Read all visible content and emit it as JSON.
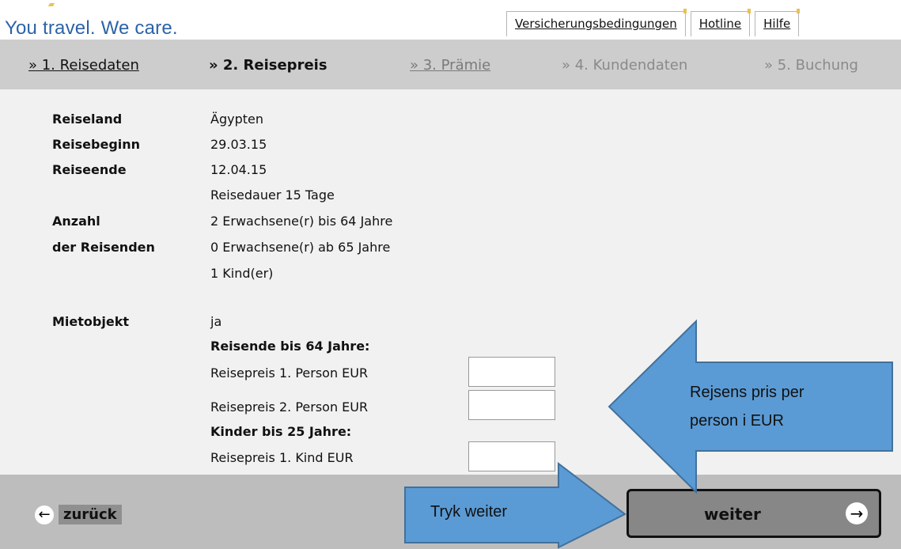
{
  "brand": {
    "tagline": "You travel. We care."
  },
  "toplinks": [
    "Versicherungsbedingungen",
    "Hotline",
    "Hilfe"
  ],
  "steps": [
    {
      "label": "» 1. Reisedaten"
    },
    {
      "label": "» 2. Reisepreis"
    },
    {
      "label": "» 3. Prämie"
    },
    {
      "label": "» 4. Kundendaten"
    },
    {
      "label": "» 5. Buchung"
    }
  ],
  "summary": {
    "reiseland_label": "Reiseland",
    "reiseland_value": "Ägypten",
    "reisebeginn_label": "Reisebeginn",
    "reisebeginn_value": "29.03.15",
    "reiseende_label": "Reiseende",
    "reiseende_value": "12.04.15",
    "reisedauer": "Reisedauer 15 Tage",
    "anzahl_label_1": "Anzahl",
    "anzahl_label_2": "der Reisenden",
    "travellers_1": "2  Erwachsene(r) bis 64 Jahre",
    "travellers_2": "0  Erwachsene(r) ab 65 Jahre",
    "travellers_3": "1  Kind(er)",
    "mietobjekt_label": "Mietobjekt",
    "mietobjekt_value": "ja"
  },
  "prices": {
    "adults_heading": "Reisende bis 64 Jahre:",
    "person1_label": "Reisepreis 1. Person EUR",
    "person2_label": "Reisepreis 2. Person EUR",
    "kids_heading": "Kinder bis 25 Jahre:",
    "kid1_label": "Reisepreis 1. Kind EUR",
    "person1_value": "",
    "person2_value": "",
    "kid1_value": ""
  },
  "footer": {
    "back_label": "zurück",
    "next_label": "weiter"
  },
  "annotations": {
    "price_note_1": "Rejsens pris per",
    "price_note_2": "person i EUR",
    "next_note": "Tryk weiter",
    "arrow_color": "#5b9bd5",
    "arrow_outline": "#41719c"
  }
}
